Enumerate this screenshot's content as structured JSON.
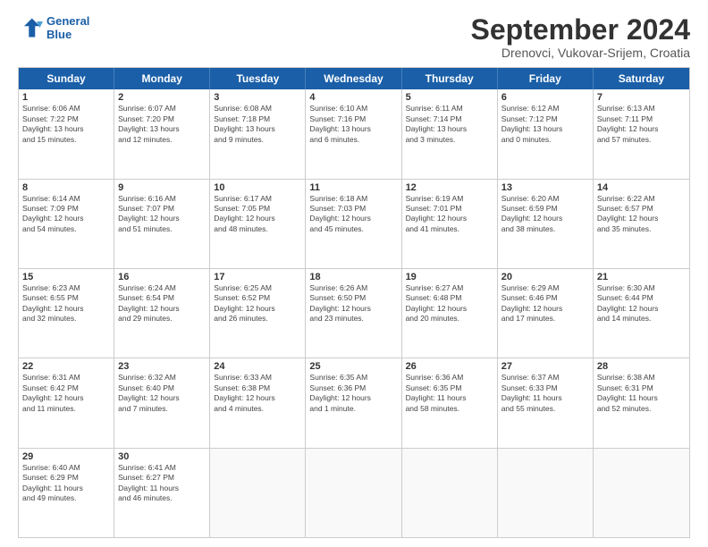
{
  "header": {
    "logo": {
      "line1": "General",
      "line2": "Blue"
    },
    "title": "September 2024",
    "subtitle": "Drenovci, Vukovar-Srijem, Croatia"
  },
  "calendar": {
    "days": [
      "Sunday",
      "Monday",
      "Tuesday",
      "Wednesday",
      "Thursday",
      "Friday",
      "Saturday"
    ],
    "rows": [
      [
        {
          "day": "1",
          "lines": [
            "Sunrise: 6:06 AM",
            "Sunset: 7:22 PM",
            "Daylight: 13 hours",
            "and 15 minutes."
          ]
        },
        {
          "day": "2",
          "lines": [
            "Sunrise: 6:07 AM",
            "Sunset: 7:20 PM",
            "Daylight: 13 hours",
            "and 12 minutes."
          ]
        },
        {
          "day": "3",
          "lines": [
            "Sunrise: 6:08 AM",
            "Sunset: 7:18 PM",
            "Daylight: 13 hours",
            "and 9 minutes."
          ]
        },
        {
          "day": "4",
          "lines": [
            "Sunrise: 6:10 AM",
            "Sunset: 7:16 PM",
            "Daylight: 13 hours",
            "and 6 minutes."
          ]
        },
        {
          "day": "5",
          "lines": [
            "Sunrise: 6:11 AM",
            "Sunset: 7:14 PM",
            "Daylight: 13 hours",
            "and 3 minutes."
          ]
        },
        {
          "day": "6",
          "lines": [
            "Sunrise: 6:12 AM",
            "Sunset: 7:12 PM",
            "Daylight: 13 hours",
            "and 0 minutes."
          ]
        },
        {
          "day": "7",
          "lines": [
            "Sunrise: 6:13 AM",
            "Sunset: 7:11 PM",
            "Daylight: 12 hours",
            "and 57 minutes."
          ]
        }
      ],
      [
        {
          "day": "8",
          "lines": [
            "Sunrise: 6:14 AM",
            "Sunset: 7:09 PM",
            "Daylight: 12 hours",
            "and 54 minutes."
          ]
        },
        {
          "day": "9",
          "lines": [
            "Sunrise: 6:16 AM",
            "Sunset: 7:07 PM",
            "Daylight: 12 hours",
            "and 51 minutes."
          ]
        },
        {
          "day": "10",
          "lines": [
            "Sunrise: 6:17 AM",
            "Sunset: 7:05 PM",
            "Daylight: 12 hours",
            "and 48 minutes."
          ]
        },
        {
          "day": "11",
          "lines": [
            "Sunrise: 6:18 AM",
            "Sunset: 7:03 PM",
            "Daylight: 12 hours",
            "and 45 minutes."
          ]
        },
        {
          "day": "12",
          "lines": [
            "Sunrise: 6:19 AM",
            "Sunset: 7:01 PM",
            "Daylight: 12 hours",
            "and 41 minutes."
          ]
        },
        {
          "day": "13",
          "lines": [
            "Sunrise: 6:20 AM",
            "Sunset: 6:59 PM",
            "Daylight: 12 hours",
            "and 38 minutes."
          ]
        },
        {
          "day": "14",
          "lines": [
            "Sunrise: 6:22 AM",
            "Sunset: 6:57 PM",
            "Daylight: 12 hours",
            "and 35 minutes."
          ]
        }
      ],
      [
        {
          "day": "15",
          "lines": [
            "Sunrise: 6:23 AM",
            "Sunset: 6:55 PM",
            "Daylight: 12 hours",
            "and 32 minutes."
          ]
        },
        {
          "day": "16",
          "lines": [
            "Sunrise: 6:24 AM",
            "Sunset: 6:54 PM",
            "Daylight: 12 hours",
            "and 29 minutes."
          ]
        },
        {
          "day": "17",
          "lines": [
            "Sunrise: 6:25 AM",
            "Sunset: 6:52 PM",
            "Daylight: 12 hours",
            "and 26 minutes."
          ]
        },
        {
          "day": "18",
          "lines": [
            "Sunrise: 6:26 AM",
            "Sunset: 6:50 PM",
            "Daylight: 12 hours",
            "and 23 minutes."
          ]
        },
        {
          "day": "19",
          "lines": [
            "Sunrise: 6:27 AM",
            "Sunset: 6:48 PM",
            "Daylight: 12 hours",
            "and 20 minutes."
          ]
        },
        {
          "day": "20",
          "lines": [
            "Sunrise: 6:29 AM",
            "Sunset: 6:46 PM",
            "Daylight: 12 hours",
            "and 17 minutes."
          ]
        },
        {
          "day": "21",
          "lines": [
            "Sunrise: 6:30 AM",
            "Sunset: 6:44 PM",
            "Daylight: 12 hours",
            "and 14 minutes."
          ]
        }
      ],
      [
        {
          "day": "22",
          "lines": [
            "Sunrise: 6:31 AM",
            "Sunset: 6:42 PM",
            "Daylight: 12 hours",
            "and 11 minutes."
          ]
        },
        {
          "day": "23",
          "lines": [
            "Sunrise: 6:32 AM",
            "Sunset: 6:40 PM",
            "Daylight: 12 hours",
            "and 7 minutes."
          ]
        },
        {
          "day": "24",
          "lines": [
            "Sunrise: 6:33 AM",
            "Sunset: 6:38 PM",
            "Daylight: 12 hours",
            "and 4 minutes."
          ]
        },
        {
          "day": "25",
          "lines": [
            "Sunrise: 6:35 AM",
            "Sunset: 6:36 PM",
            "Daylight: 12 hours",
            "and 1 minute."
          ]
        },
        {
          "day": "26",
          "lines": [
            "Sunrise: 6:36 AM",
            "Sunset: 6:35 PM",
            "Daylight: 11 hours",
            "and 58 minutes."
          ]
        },
        {
          "day": "27",
          "lines": [
            "Sunrise: 6:37 AM",
            "Sunset: 6:33 PM",
            "Daylight: 11 hours",
            "and 55 minutes."
          ]
        },
        {
          "day": "28",
          "lines": [
            "Sunrise: 6:38 AM",
            "Sunset: 6:31 PM",
            "Daylight: 11 hours",
            "and 52 minutes."
          ]
        }
      ],
      [
        {
          "day": "29",
          "lines": [
            "Sunrise: 6:40 AM",
            "Sunset: 6:29 PM",
            "Daylight: 11 hours",
            "and 49 minutes."
          ]
        },
        {
          "day": "30",
          "lines": [
            "Sunrise: 6:41 AM",
            "Sunset: 6:27 PM",
            "Daylight: 11 hours",
            "and 46 minutes."
          ]
        },
        {
          "day": "",
          "lines": []
        },
        {
          "day": "",
          "lines": []
        },
        {
          "day": "",
          "lines": []
        },
        {
          "day": "",
          "lines": []
        },
        {
          "day": "",
          "lines": []
        }
      ]
    ]
  }
}
